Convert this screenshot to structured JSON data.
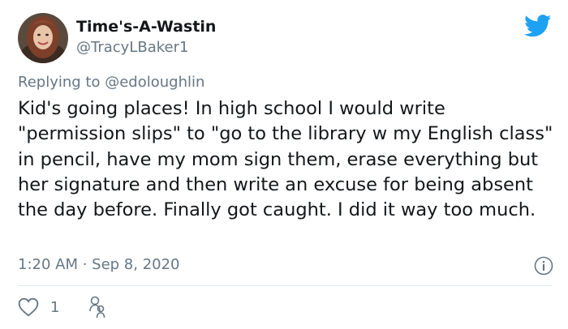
{
  "author": {
    "display_name": "Time's-A-Wastin",
    "handle": "@TracyLBaker1"
  },
  "reply": {
    "prefix": "Replying to",
    "mention": "@edoloughlin"
  },
  "tweet_text": "Kid's going places! In high school I would write \"permission slips\" to \"go to the library w my English class\" in pencil, have my mom sign them, erase everything but her signature and then write an excuse for being absent the day before. Finally got caught. I did it way too much.",
  "timestamp": "1:20 AM · Sep 8, 2020",
  "actions": {
    "like_count": "1"
  },
  "icons": {
    "brand": "twitter-bird-icon",
    "info": "info-icon",
    "like": "heart-icon",
    "share": "people-icon"
  },
  "colors": {
    "brand": "#1da1f2",
    "secondary_text": "#657786",
    "primary_text": "#14171a",
    "divider": "#e1e8ed"
  }
}
